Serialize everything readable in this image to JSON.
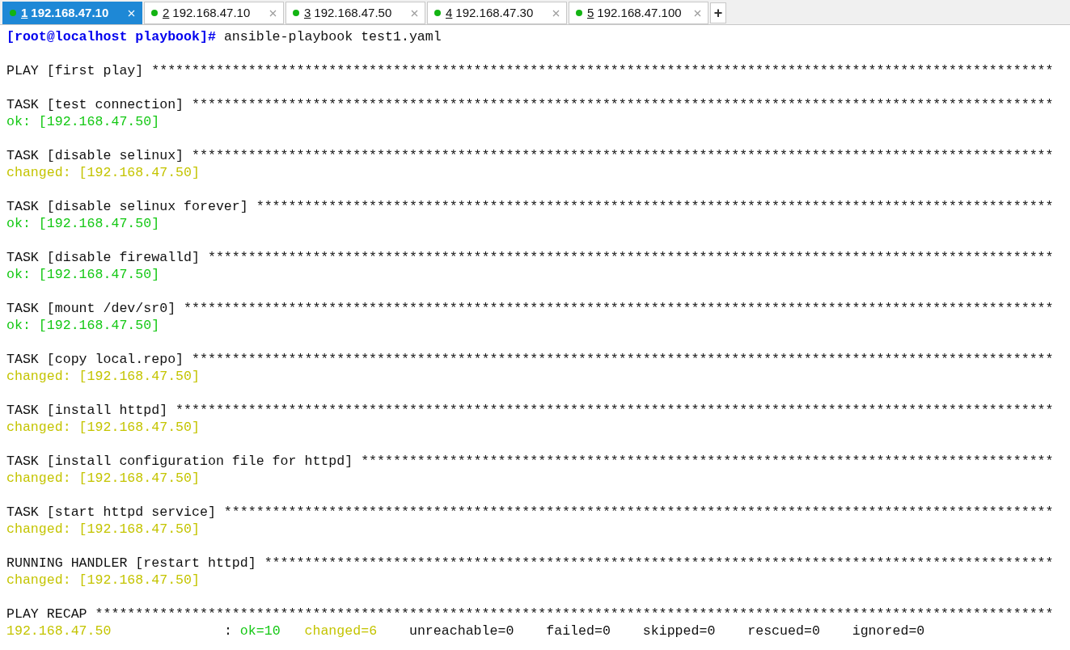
{
  "tabs": [
    {
      "number": "1",
      "label": "192.168.47.10",
      "selected": true
    },
    {
      "number": "2",
      "label": "192.168.47.10",
      "selected": false
    },
    {
      "number": "3",
      "label": "192.168.47.50",
      "selected": false
    },
    {
      "number": "4",
      "label": "192.168.47.30",
      "selected": false
    },
    {
      "number": "5",
      "label": "192.168.47.100",
      "selected": false
    }
  ],
  "new_tab_button": "+",
  "terminal": {
    "blocks": [
      [
        [
          {
            "kind": "prompt",
            "text": "[root@localhost playbook]#"
          },
          {
            "kind": "plain",
            "text": " ansible-playbook test1.yaml"
          }
        ]
      ],
      [
        [
          {
            "kind": "plain",
            "text": "PLAY [first play] ****************************************************************************************************************"
          }
        ]
      ],
      [
        [
          {
            "kind": "plain",
            "text": "TASK [test connection] ***********************************************************************************************************"
          }
        ],
        [
          {
            "kind": "ok",
            "text": "ok: [192.168.47.50]"
          }
        ]
      ],
      [
        [
          {
            "kind": "plain",
            "text": "TASK [disable selinux] ***********************************************************************************************************"
          }
        ],
        [
          {
            "kind": "changed",
            "text": "changed: [192.168.47.50]"
          }
        ]
      ],
      [
        [
          {
            "kind": "plain",
            "text": "TASK [disable selinux forever] ***************************************************************************************************"
          }
        ],
        [
          {
            "kind": "ok",
            "text": "ok: [192.168.47.50]"
          }
        ]
      ],
      [
        [
          {
            "kind": "plain",
            "text": "TASK [disable firewalld] *********************************************************************************************************"
          }
        ],
        [
          {
            "kind": "ok",
            "text": "ok: [192.168.47.50]"
          }
        ]
      ],
      [
        [
          {
            "kind": "plain",
            "text": "TASK [mount /dev/sr0] ************************************************************************************************************"
          }
        ],
        [
          {
            "kind": "ok",
            "text": "ok: [192.168.47.50]"
          }
        ]
      ],
      [
        [
          {
            "kind": "plain",
            "text": "TASK [copy local.repo] ***********************************************************************************************************"
          }
        ],
        [
          {
            "kind": "changed",
            "text": "changed: [192.168.47.50]"
          }
        ]
      ],
      [
        [
          {
            "kind": "plain",
            "text": "TASK [install httpd] *************************************************************************************************************"
          }
        ],
        [
          {
            "kind": "changed",
            "text": "changed: [192.168.47.50]"
          }
        ]
      ],
      [
        [
          {
            "kind": "plain",
            "text": "TASK [install configuration file for httpd] **************************************************************************************"
          }
        ],
        [
          {
            "kind": "changed",
            "text": "changed: [192.168.47.50]"
          }
        ]
      ],
      [
        [
          {
            "kind": "plain",
            "text": "TASK [start httpd service] *******************************************************************************************************"
          }
        ],
        [
          {
            "kind": "changed",
            "text": "changed: [192.168.47.50]"
          }
        ]
      ],
      [
        [
          {
            "kind": "plain",
            "text": "RUNNING HANDLER [restart httpd] **************************************************************************************************"
          }
        ],
        [
          {
            "kind": "changed",
            "text": "changed: [192.168.47.50]"
          }
        ]
      ],
      [
        [
          {
            "kind": "plain",
            "text": "PLAY RECAP ***********************************************************************************************************************"
          }
        ],
        [
          {
            "kind": "changed",
            "text": "192.168.47.50"
          },
          {
            "kind": "plain",
            "text": "              : "
          },
          {
            "kind": "ok",
            "text": "ok=10"
          },
          {
            "kind": "changed",
            "text": "   changed=6"
          },
          {
            "kind": "plain",
            "text": "    unreachable=0"
          },
          {
            "kind": "plain",
            "text": "    failed=0"
          },
          {
            "kind": "plain",
            "text": "    skipped=0"
          },
          {
            "kind": "plain",
            "text": "    rescued=0"
          },
          {
            "kind": "plain",
            "text": "    ignored=0"
          }
        ]
      ]
    ]
  }
}
